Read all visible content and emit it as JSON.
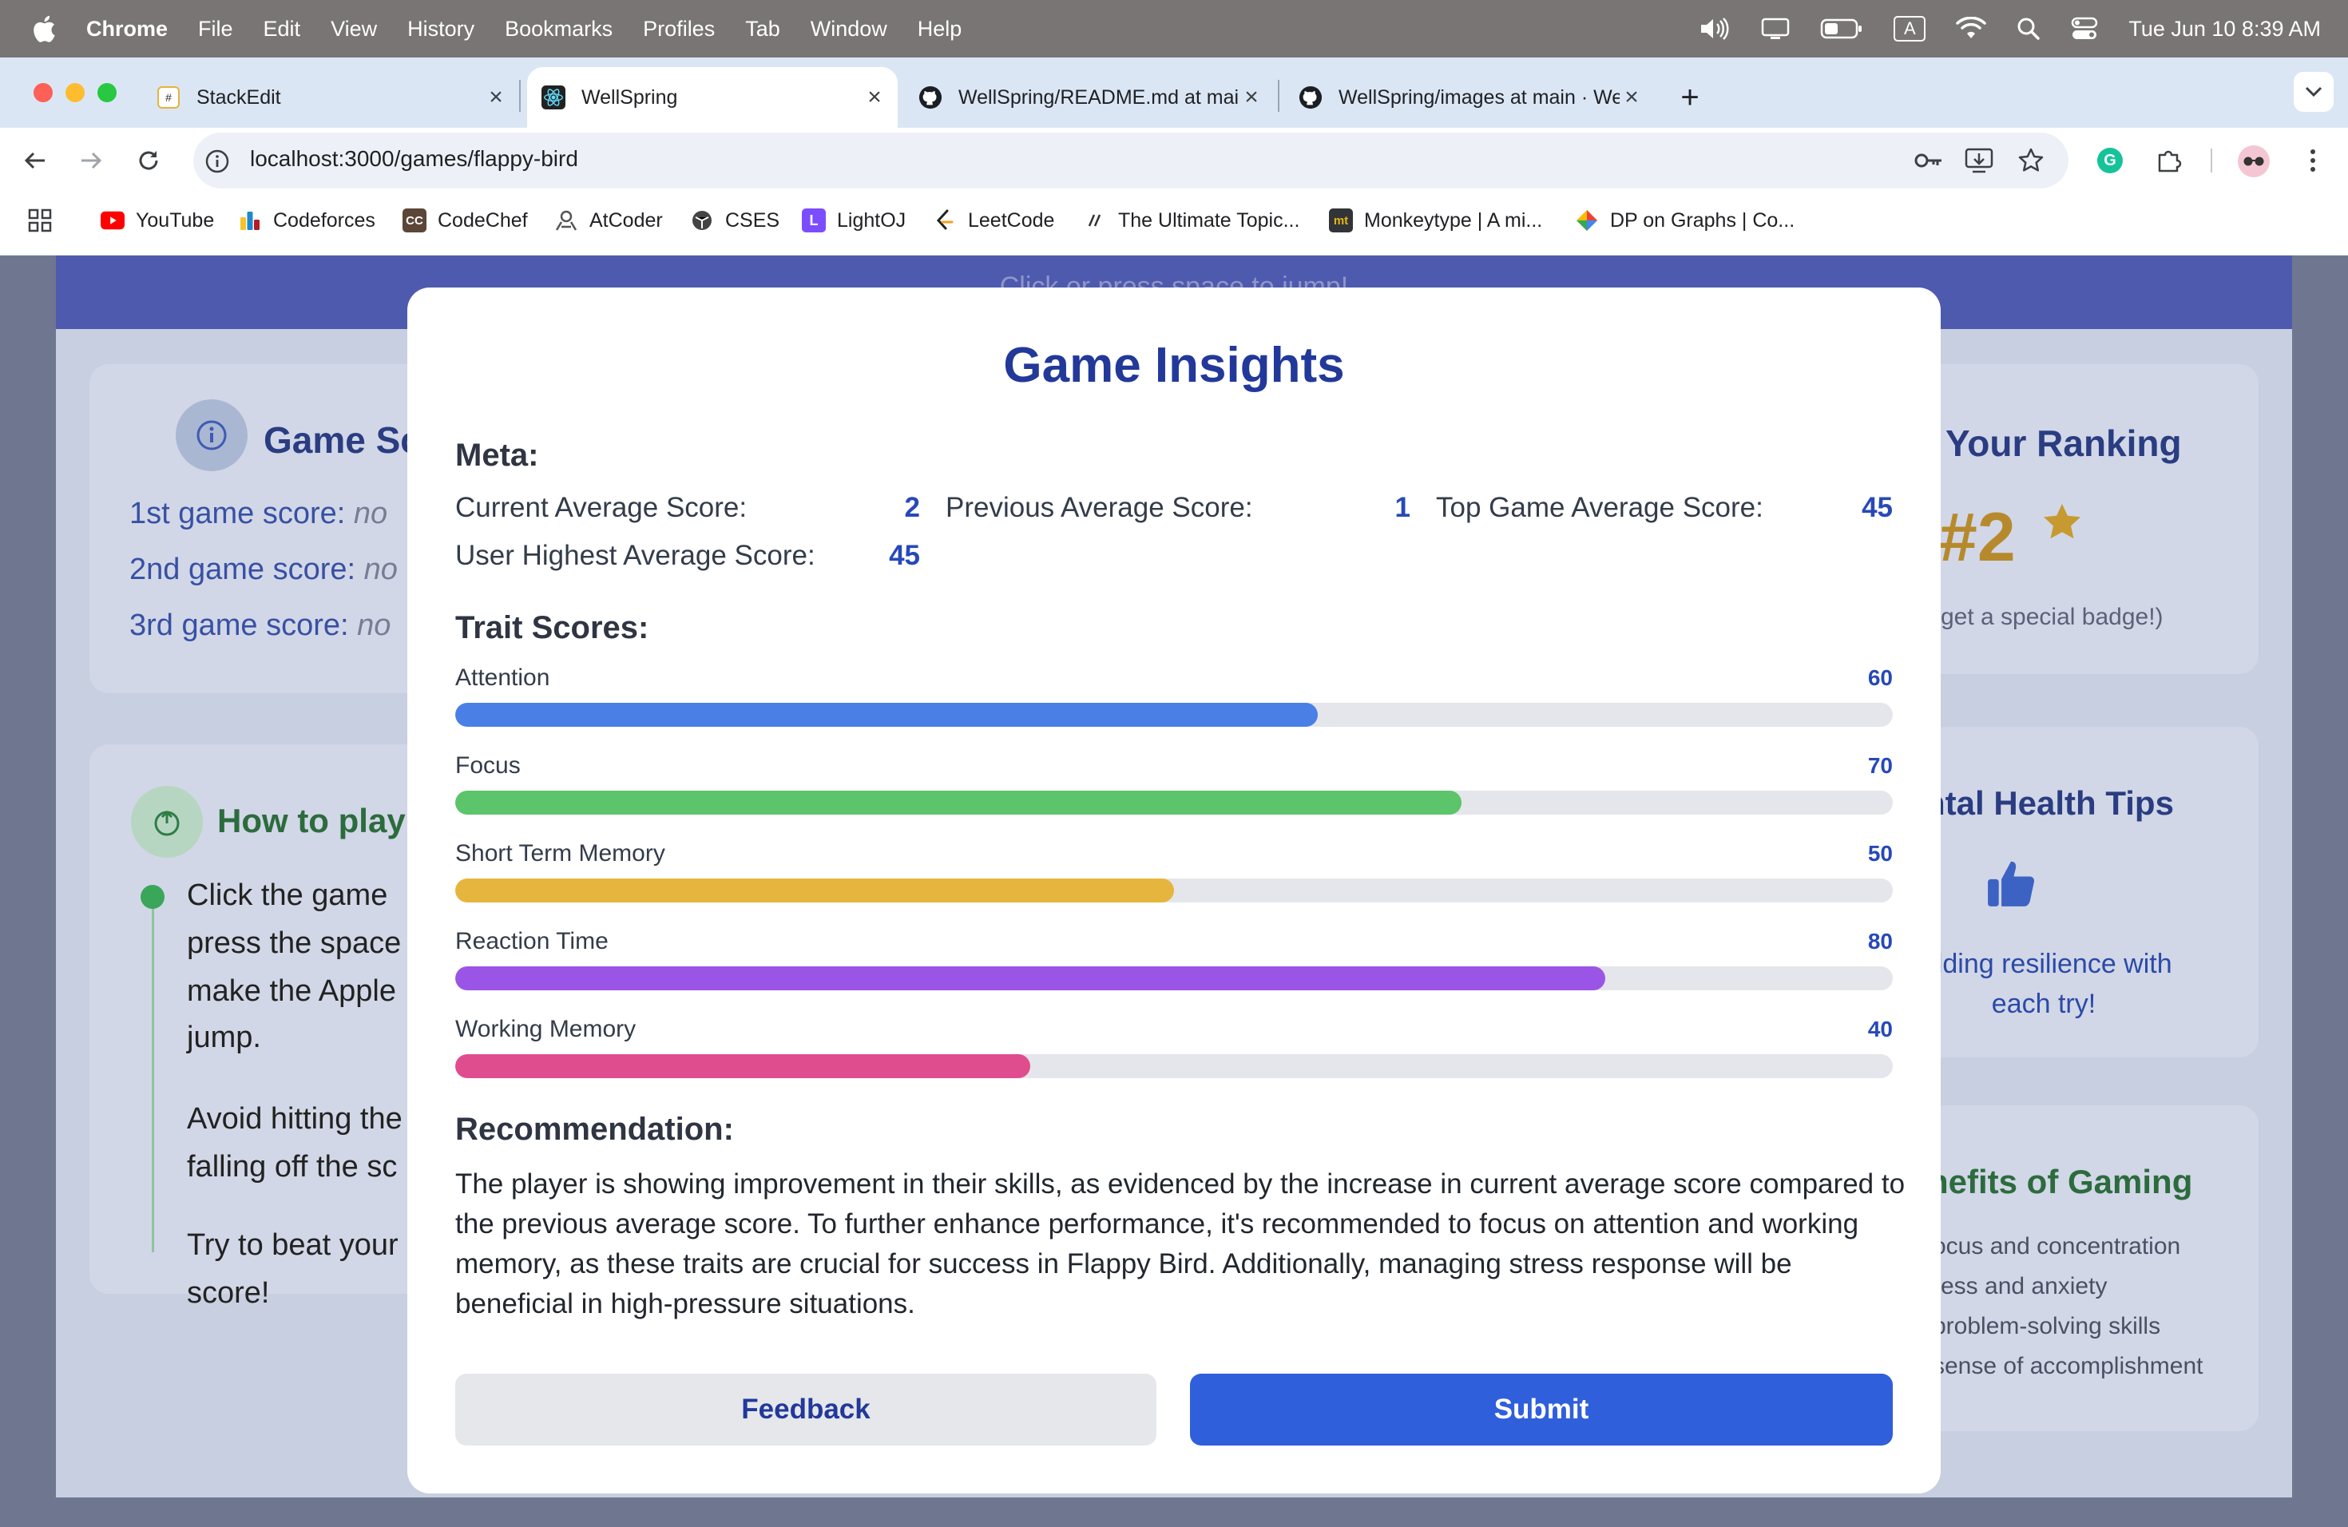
{
  "menubar": {
    "items": [
      "Chrome",
      "File",
      "Edit",
      "View",
      "History",
      "Bookmarks",
      "Profiles",
      "Tab",
      "Window",
      "Help"
    ],
    "clock": "Tue Jun 10  8:39 AM",
    "input_indicator": "A"
  },
  "tabs": [
    {
      "title": "StackEdit",
      "icon": "stackedit-icon"
    },
    {
      "title": "WellSpring",
      "icon": "react-icon"
    },
    {
      "title": "WellSpring/README.md at main · WellSpring",
      "icon": "github-icon"
    },
    {
      "title": "WellSpring/images at main · WellSpring",
      "icon": "github-icon"
    }
  ],
  "new_tab_label": "+",
  "address_bar": {
    "url": "localhost:3000/games/flappy-bird"
  },
  "bookmarks": [
    {
      "label": "YouTube",
      "icon": "youtube-icon",
      "color": "#ff0000"
    },
    {
      "label": "Codeforces",
      "icon": "codeforces-icon",
      "color": "#1f8acb"
    },
    {
      "label": "CodeChef",
      "icon": "codechef-icon",
      "color": "#5b4638",
      "mark": "CC"
    },
    {
      "label": "AtCoder",
      "icon": "atcoder-icon",
      "color": "#555555"
    },
    {
      "label": "CSES",
      "icon": "cses-icon",
      "color": "#444444"
    },
    {
      "label": "LightOJ",
      "icon": "lightoj-icon",
      "color": "#7c4dff",
      "mark": "L"
    },
    {
      "label": "LeetCode",
      "icon": "leetcode-icon",
      "color": "#f89f1b"
    },
    {
      "label": "The Ultimate Topic...",
      "icon": "topic-icon",
      "color": "#333333"
    },
    {
      "label": "Monkeytype | A mi...",
      "icon": "monkeytype-icon",
      "color": "#e2b714",
      "mark": "mt"
    },
    {
      "label": "DP on Graphs | Co...",
      "icon": "dp-graphs-icon",
      "color": "#34a853"
    }
  ],
  "background_page": {
    "banner_text": "Click or press space to jump!",
    "scores_card": {
      "title": "Game Sc",
      "rows": [
        {
          "label": "1st game score:",
          "value": "no"
        },
        {
          "label": "2nd game score:",
          "value": "no"
        },
        {
          "label": "3rd game score:",
          "value": "no"
        }
      ]
    },
    "howto_card": {
      "title": "How to play",
      "steps": [
        "Click the game",
        "press the space",
        "make the Apple",
        "jump.",
        "Avoid hitting the",
        "falling off the sc",
        "Try to beat your",
        "score!"
      ]
    },
    "ranking_card": {
      "title": "Your Ranking",
      "rank": "#2",
      "note": "get a special badge!)"
    },
    "tips_card": {
      "title": "ntal Health Tips",
      "tip_lines": [
        "uilding resilience with",
        "each try!"
      ]
    },
    "benefits_card": {
      "title": "nefits of Gaming",
      "items": [
        "ocus and concentration",
        "ress and anxiety",
        "problem-solving skills",
        "sense of accomplishment"
      ]
    }
  },
  "modal": {
    "title": "Game Insights",
    "meta_heading": "Meta:",
    "meta": [
      {
        "label": "Current Average Score:",
        "value": "2"
      },
      {
        "label": "Previous Average Score:",
        "value": "1"
      },
      {
        "label": "Top Game Average Score:",
        "value": "45"
      },
      {
        "label": "User Highest Average Score:",
        "value": "45"
      }
    ],
    "traits_heading": "Trait Scores:",
    "traits": [
      {
        "name": "Attention",
        "score": 60,
        "score_text": "60",
        "color": "#4a7fe6"
      },
      {
        "name": "Focus",
        "score": 70,
        "score_text": "70",
        "color": "#5cc46a"
      },
      {
        "name": "Short Term Memory",
        "score": 50,
        "score_text": "50",
        "color": "#e6b53e"
      },
      {
        "name": "Reaction Time",
        "score": 80,
        "score_text": "80",
        "color": "#9a55e6"
      },
      {
        "name": "Working Memory",
        "score": 40,
        "score_text": "40",
        "color": "#df4d8f"
      }
    ],
    "recommendation_heading": "Recommendation:",
    "recommendation": "The player is showing improvement in their skills, as evidenced by the increase in current average score compared to the previous average score. To further enhance performance, it's recommended to focus on attention and working memory, as these traits are crucial for success in Flappy Bird. Additionally, managing stress response will be beneficial in high-pressure situations.",
    "feedback_label": "Feedback",
    "submit_label": "Submit"
  },
  "colors": {
    "accent": "#2f5fdb",
    "title": "#22399a",
    "value": "#2749b8"
  }
}
